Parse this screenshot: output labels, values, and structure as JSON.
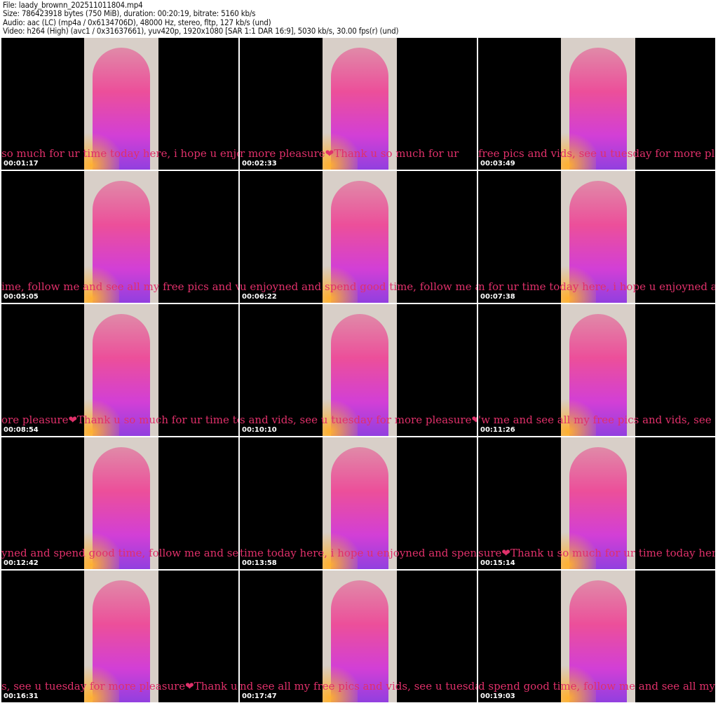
{
  "header": {
    "file": "File: laady_brownn_202511011804.mp4",
    "size": "Size: 786423918 bytes (750 MiB), duration: 00:20:19, bitrate: 5160 kb/s",
    "audio": "Audio: aac (LC) (mp4a / 0x6134706D), 48000 Hz, stereo, fltp, 127 kb/s (und)",
    "video": "Video: h264 (High) (avc1 / 0x31637661), yuv420p, 1920x1080 [SAR 1:1 DAR 16:9], 5030 kb/s, 30.00 fps(r) (und)"
  },
  "thumbnails": [
    {
      "time": "00:01:17",
      "caption": "so much for ur time today here, i hope u enjoy"
    },
    {
      "time": "00:02:33",
      "caption": "r more pleasure❤Thank u so much for ur"
    },
    {
      "time": "00:03:49",
      "caption": "free pics and vids, see u tuesday for more plea"
    },
    {
      "time": "00:05:05",
      "caption": "ime, follow me and see all my free pics and vi"
    },
    {
      "time": "00:06:22",
      "caption": "u enjoyned and spend good time, follow me a"
    },
    {
      "time": "00:07:38",
      "caption": "n for ur time today here, i hope u enjoyned an"
    },
    {
      "time": "00:08:54",
      "caption": "ore pleasure❤Thank u so much for ur time to"
    },
    {
      "time": "00:10:10",
      "caption": "s and vids, see u tuesday for more pleasure❤"
    },
    {
      "time": "00:11:26",
      "caption": "'w me and see all my free pics and vids, see u"
    },
    {
      "time": "00:12:42",
      "caption": "yned and spend good time, follow me and see"
    },
    {
      "time": "00:13:58",
      "caption": "time today here, i hope u enjoyned and spen"
    },
    {
      "time": "00:15:14",
      "caption": "sure❤Thank u so much for ur time today here"
    },
    {
      "time": "00:16:31",
      "caption": "s, see u tuesday for more pleasure❤Thank u"
    },
    {
      "time": "00:17:47",
      "caption": "nd see all my free pics and vids, see u tuesda"
    },
    {
      "time": "00:19:03",
      "caption": "d spend good time, follow me and see all my fr"
    }
  ]
}
